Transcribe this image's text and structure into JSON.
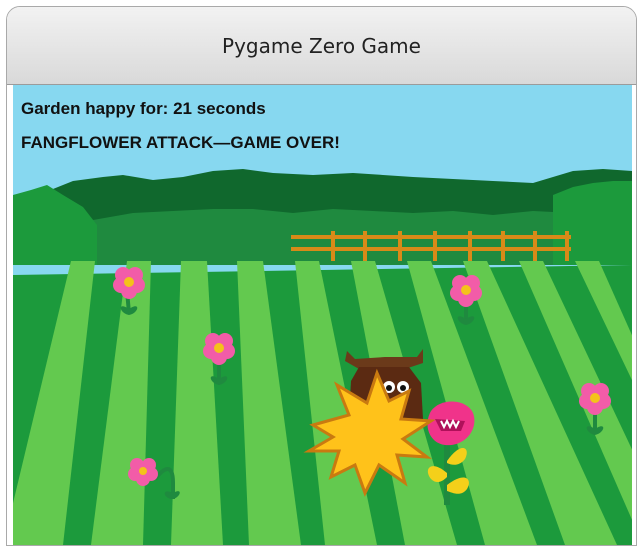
{
  "window": {
    "title": "Pygame Zero Game"
  },
  "hud": {
    "score_text": "Garden happy for: 21 seconds",
    "message": "FANGFLOWER ATTACK—GAME OVER!"
  },
  "colors": {
    "sky": "#87d8f0",
    "hills": "#1f8a3f",
    "trees_dark": "#10682d",
    "lawn_light": "#63c94f",
    "lawn_dark": "#1c9a3c",
    "fence": "#d88a18",
    "flower_petal": "#f25ca8",
    "flower_center": "#f4c21a",
    "stem": "#1f8a3f",
    "fangflower": "#f0338a",
    "cow_body": "#5b2a12",
    "burst": "#ffc21a"
  },
  "sprites": {
    "flowers": [
      "flower",
      "flower",
      "flower",
      "flower",
      "flower",
      "wilted-flower"
    ],
    "cow": "cow",
    "fangflower": "fangflower",
    "zap": "zap-burst"
  }
}
